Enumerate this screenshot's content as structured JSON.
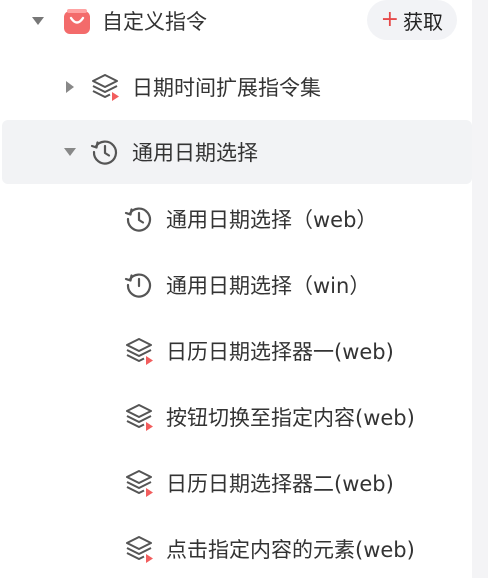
{
  "group": {
    "title": "自定义指令",
    "fetch_button": {
      "plus": "+",
      "label": "获取"
    }
  },
  "tree": {
    "collapsed_item": {
      "label": "日期时间扩展指令集",
      "icon": "layers-icon"
    },
    "expanded_item": {
      "label": "通用日期选择",
      "icon": "history-clock-icon",
      "children": [
        {
          "label": "通用日期选择（web）",
          "icon": "history-clock-icon"
        },
        {
          "label": "通用日期选择（win）",
          "icon": "history-clock-icon"
        },
        {
          "label": "日历日期选择器一(web)",
          "icon": "layers-icon"
        },
        {
          "label": "按钮切换至指定内容(web)",
          "icon": "layers-icon"
        },
        {
          "label": "日历日期选择器二(web)",
          "icon": "layers-icon"
        },
        {
          "label": "点击指定内容的元素(web)",
          "icon": "layers-icon"
        }
      ]
    }
  },
  "colors": {
    "accent_red": "#f25d5d",
    "selected_row_bg": "#f2f3f5",
    "text": "#333333",
    "icon_gray": "#555555"
  }
}
